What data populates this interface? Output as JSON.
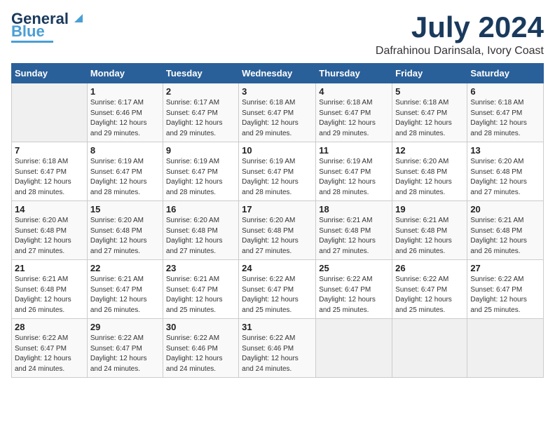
{
  "logo": {
    "line1": "General",
    "line2": "Blue"
  },
  "title": "July 2024",
  "location": "Dafrahinou Darinsala, Ivory Coast",
  "weekdays": [
    "Sunday",
    "Monday",
    "Tuesday",
    "Wednesday",
    "Thursday",
    "Friday",
    "Saturday"
  ],
  "weeks": [
    [
      {
        "day": "",
        "info": ""
      },
      {
        "day": "1",
        "info": "Sunrise: 6:17 AM\nSunset: 6:46 PM\nDaylight: 12 hours\nand 29 minutes."
      },
      {
        "day": "2",
        "info": "Sunrise: 6:17 AM\nSunset: 6:47 PM\nDaylight: 12 hours\nand 29 minutes."
      },
      {
        "day": "3",
        "info": "Sunrise: 6:18 AM\nSunset: 6:47 PM\nDaylight: 12 hours\nand 29 minutes."
      },
      {
        "day": "4",
        "info": "Sunrise: 6:18 AM\nSunset: 6:47 PM\nDaylight: 12 hours\nand 29 minutes."
      },
      {
        "day": "5",
        "info": "Sunrise: 6:18 AM\nSunset: 6:47 PM\nDaylight: 12 hours\nand 28 minutes."
      },
      {
        "day": "6",
        "info": "Sunrise: 6:18 AM\nSunset: 6:47 PM\nDaylight: 12 hours\nand 28 minutes."
      }
    ],
    [
      {
        "day": "7",
        "info": "Sunrise: 6:18 AM\nSunset: 6:47 PM\nDaylight: 12 hours\nand 28 minutes."
      },
      {
        "day": "8",
        "info": "Sunrise: 6:19 AM\nSunset: 6:47 PM\nDaylight: 12 hours\nand 28 minutes."
      },
      {
        "day": "9",
        "info": "Sunrise: 6:19 AM\nSunset: 6:47 PM\nDaylight: 12 hours\nand 28 minutes."
      },
      {
        "day": "10",
        "info": "Sunrise: 6:19 AM\nSunset: 6:47 PM\nDaylight: 12 hours\nand 28 minutes."
      },
      {
        "day": "11",
        "info": "Sunrise: 6:19 AM\nSunset: 6:47 PM\nDaylight: 12 hours\nand 28 minutes."
      },
      {
        "day": "12",
        "info": "Sunrise: 6:20 AM\nSunset: 6:48 PM\nDaylight: 12 hours\nand 28 minutes."
      },
      {
        "day": "13",
        "info": "Sunrise: 6:20 AM\nSunset: 6:48 PM\nDaylight: 12 hours\nand 27 minutes."
      }
    ],
    [
      {
        "day": "14",
        "info": "Sunrise: 6:20 AM\nSunset: 6:48 PM\nDaylight: 12 hours\nand 27 minutes."
      },
      {
        "day": "15",
        "info": "Sunrise: 6:20 AM\nSunset: 6:48 PM\nDaylight: 12 hours\nand 27 minutes."
      },
      {
        "day": "16",
        "info": "Sunrise: 6:20 AM\nSunset: 6:48 PM\nDaylight: 12 hours\nand 27 minutes."
      },
      {
        "day": "17",
        "info": "Sunrise: 6:20 AM\nSunset: 6:48 PM\nDaylight: 12 hours\nand 27 minutes."
      },
      {
        "day": "18",
        "info": "Sunrise: 6:21 AM\nSunset: 6:48 PM\nDaylight: 12 hours\nand 27 minutes."
      },
      {
        "day": "19",
        "info": "Sunrise: 6:21 AM\nSunset: 6:48 PM\nDaylight: 12 hours\nand 26 minutes."
      },
      {
        "day": "20",
        "info": "Sunrise: 6:21 AM\nSunset: 6:48 PM\nDaylight: 12 hours\nand 26 minutes."
      }
    ],
    [
      {
        "day": "21",
        "info": "Sunrise: 6:21 AM\nSunset: 6:48 PM\nDaylight: 12 hours\nand 26 minutes."
      },
      {
        "day": "22",
        "info": "Sunrise: 6:21 AM\nSunset: 6:47 PM\nDaylight: 12 hours\nand 26 minutes."
      },
      {
        "day": "23",
        "info": "Sunrise: 6:21 AM\nSunset: 6:47 PM\nDaylight: 12 hours\nand 25 minutes."
      },
      {
        "day": "24",
        "info": "Sunrise: 6:22 AM\nSunset: 6:47 PM\nDaylight: 12 hours\nand 25 minutes."
      },
      {
        "day": "25",
        "info": "Sunrise: 6:22 AM\nSunset: 6:47 PM\nDaylight: 12 hours\nand 25 minutes."
      },
      {
        "day": "26",
        "info": "Sunrise: 6:22 AM\nSunset: 6:47 PM\nDaylight: 12 hours\nand 25 minutes."
      },
      {
        "day": "27",
        "info": "Sunrise: 6:22 AM\nSunset: 6:47 PM\nDaylight: 12 hours\nand 25 minutes."
      }
    ],
    [
      {
        "day": "28",
        "info": "Sunrise: 6:22 AM\nSunset: 6:47 PM\nDaylight: 12 hours\nand 24 minutes."
      },
      {
        "day": "29",
        "info": "Sunrise: 6:22 AM\nSunset: 6:47 PM\nDaylight: 12 hours\nand 24 minutes."
      },
      {
        "day": "30",
        "info": "Sunrise: 6:22 AM\nSunset: 6:46 PM\nDaylight: 12 hours\nand 24 minutes."
      },
      {
        "day": "31",
        "info": "Sunrise: 6:22 AM\nSunset: 6:46 PM\nDaylight: 12 hours\nand 24 minutes."
      },
      {
        "day": "",
        "info": ""
      },
      {
        "day": "",
        "info": ""
      },
      {
        "day": "",
        "info": ""
      }
    ]
  ]
}
